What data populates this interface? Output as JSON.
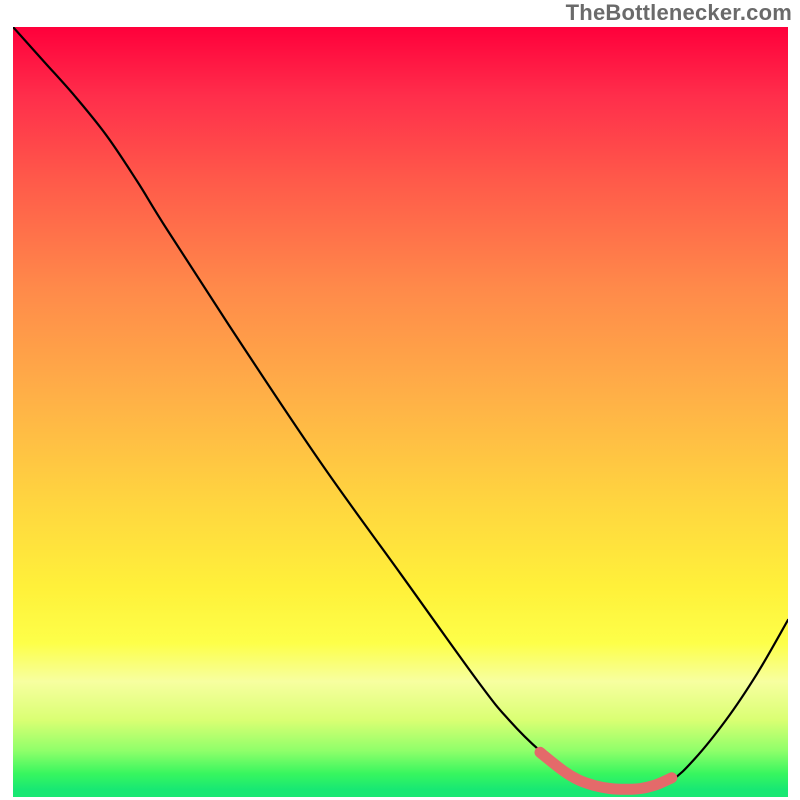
{
  "attribution": "TheBottlenecker.com",
  "colors": {
    "gradient_top": "#ff003b",
    "gradient_bottom": "#18e873",
    "curve_stroke": "#000000",
    "highlight_stroke": "#e46a6a"
  },
  "chart_data": {
    "type": "line",
    "title": "",
    "xlabel": "",
    "ylabel": "",
    "xlim": [
      0,
      100
    ],
    "ylim": [
      0,
      100
    ],
    "series": [
      {
        "name": "curve",
        "x": [
          0,
          4,
          8,
          12,
          16,
          20,
          30,
          40,
          50,
          60,
          64,
          68,
          72,
          74,
          76,
          78,
          80,
          82,
          85,
          88,
          92,
          96,
          100
        ],
        "values": [
          100,
          95.5,
          91,
          86,
          80,
          73.5,
          58,
          43,
          29,
          15,
          10,
          6,
          3,
          2,
          1.3,
          1.0,
          1.0,
          1.2,
          2.2,
          5,
          10,
          16,
          23
        ]
      },
      {
        "name": "highlight",
        "x": [
          68,
          71,
          73,
          75,
          77,
          79,
          81,
          83,
          85
        ],
        "values": [
          5.8,
          3.4,
          2.2,
          1.5,
          1.1,
          1.0,
          1.1,
          1.6,
          2.5
        ]
      }
    ],
    "annotations": []
  }
}
